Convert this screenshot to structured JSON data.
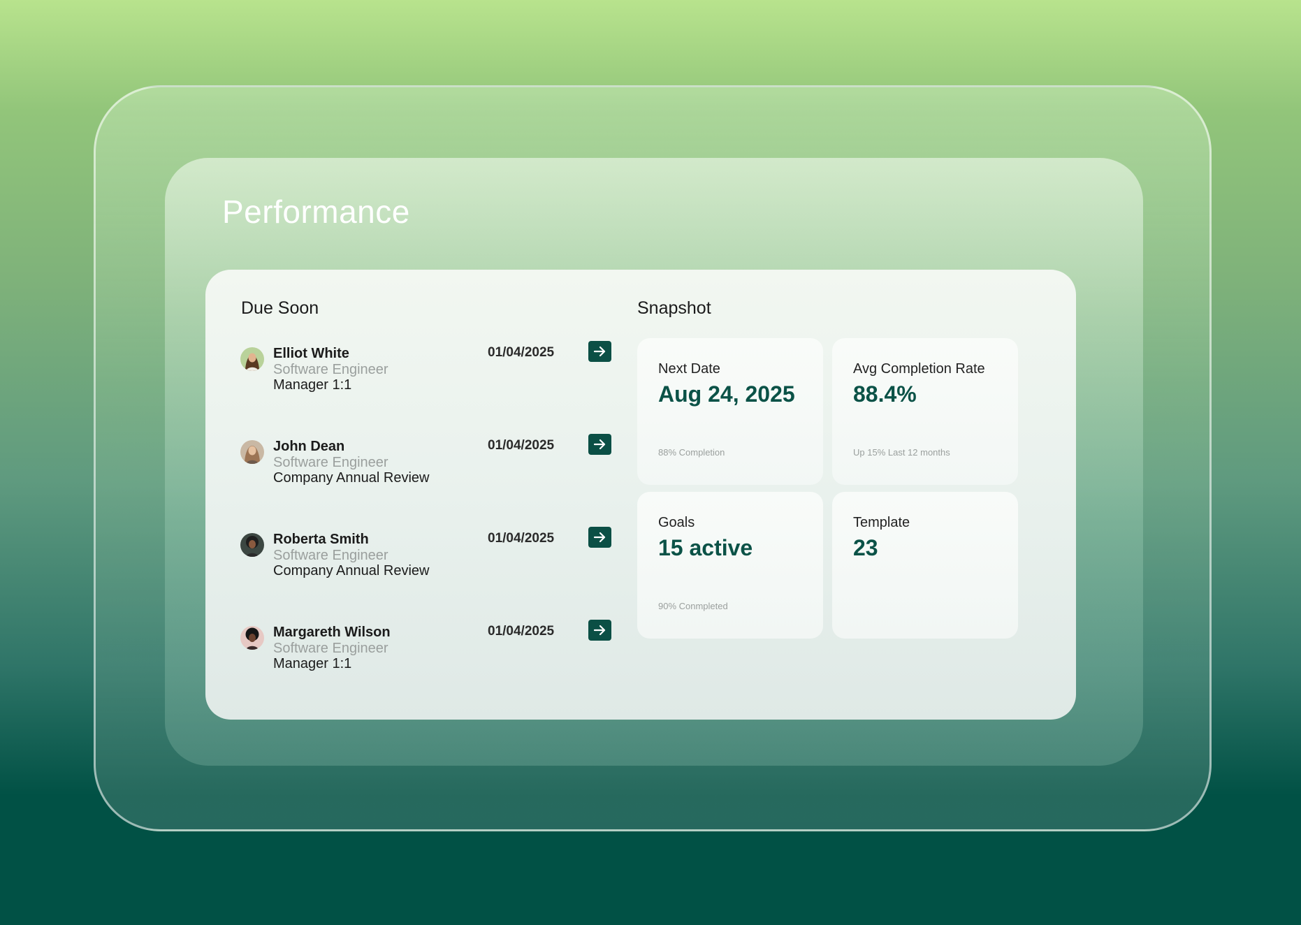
{
  "page": {
    "title": "Performance"
  },
  "due_soon": {
    "title": "Due Soon",
    "items": [
      {
        "name": "Elliot White",
        "role": "Software Engineer",
        "review": "Manager 1:1",
        "date": "01/04/2025"
      },
      {
        "name": "John Dean",
        "role": "Software Engineer",
        "review": "Company Annual Review",
        "date": "01/04/2025"
      },
      {
        "name": "Roberta Smith",
        "role": "Software Engineer",
        "review": "Company Annual Review",
        "date": "01/04/2025"
      },
      {
        "name": "Margareth Wilson",
        "role": "Software Engineer",
        "review": "Manager 1:1",
        "date": "01/04/2025"
      }
    ]
  },
  "snapshot": {
    "title": "Snapshot",
    "cards": [
      {
        "label": "Next Date",
        "value": "Aug 24, 2025",
        "sub": "88% Completion"
      },
      {
        "label": "Avg Completion Rate",
        "value": "88.4%",
        "sub": "Up 15% Last 12 months"
      },
      {
        "label": "Goals",
        "value": "15 active",
        "sub": "90% Conmpleted"
      },
      {
        "label": "Template",
        "value": "23",
        "sub": ""
      }
    ]
  },
  "colors": {
    "accent": "#0b4f45",
    "value_text": "#0b5247",
    "muted_text": "#9a9f9d"
  },
  "icons": {
    "row_action": "arrow-right-icon"
  }
}
